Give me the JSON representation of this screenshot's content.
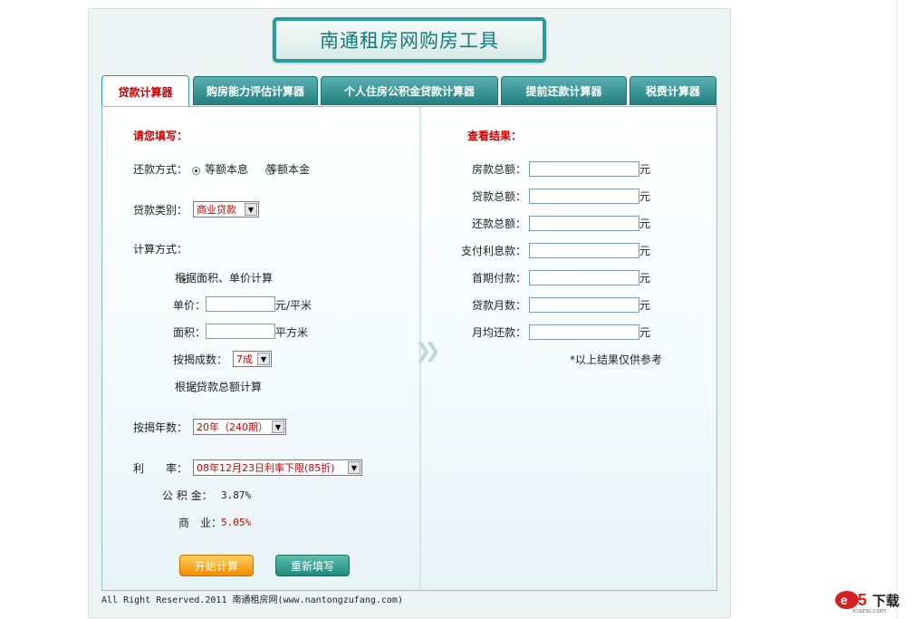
{
  "header": {
    "title": "南通租房网购房工具"
  },
  "tabs": [
    {
      "label": "贷款计算器",
      "active": true
    },
    {
      "label": "购房能力评估计算器",
      "active": false
    },
    {
      "label": "个人住房公积金贷款计算器",
      "active": false
    },
    {
      "label": "提前还款计算器",
      "active": false
    },
    {
      "label": "税费计算器",
      "active": false
    }
  ],
  "form": {
    "heading": "请您填写：",
    "repay_label": "还款方式：",
    "repay_opt1": "等额本息",
    "repay_opt2": "等额本金",
    "loan_type_label": "贷款类别：",
    "loan_type_value": "商业贷款",
    "calc_method_label": "计算方式：",
    "method1": "根据面积、单价计算",
    "price_label": "单价：",
    "price_unit": "元/平米",
    "area_label": "面积：",
    "area_unit": "平方米",
    "ratio_label": "按揭成数：",
    "ratio_value": "7成",
    "method2": "根据贷款总额计算",
    "years_label": "按揭年数：",
    "years_value": "20年（240期）",
    "rate_label": "利　　率：",
    "rate_value": "08年12月23日利率下限(85折)",
    "fund_label": "公 积 金：",
    "fund_value": "3.87%",
    "biz_label": "商　业：",
    "biz_value": "5.05%",
    "calc_button": "开始计算",
    "reset_button": "重新填写"
  },
  "results": {
    "heading": "查看结果：",
    "unit": "元",
    "rows": [
      {
        "label": "房款总额："
      },
      {
        "label": "贷款总额："
      },
      {
        "label": "还款总额："
      },
      {
        "label": "支付利息款："
      },
      {
        "label": "首期付款："
      },
      {
        "label": "贷款月数："
      },
      {
        "label": "月均还款："
      }
    ],
    "note": "*以上结果仅供参考"
  },
  "footer": {
    "text": "All Right Reserved.2011 南通租房网(www.nantongzufang.com)"
  },
  "watermark": {
    "brand": "下载",
    "site": "xiazai.com"
  },
  "colors": {
    "accent": "#2a9a9a",
    "highlight": "#cc0000"
  }
}
